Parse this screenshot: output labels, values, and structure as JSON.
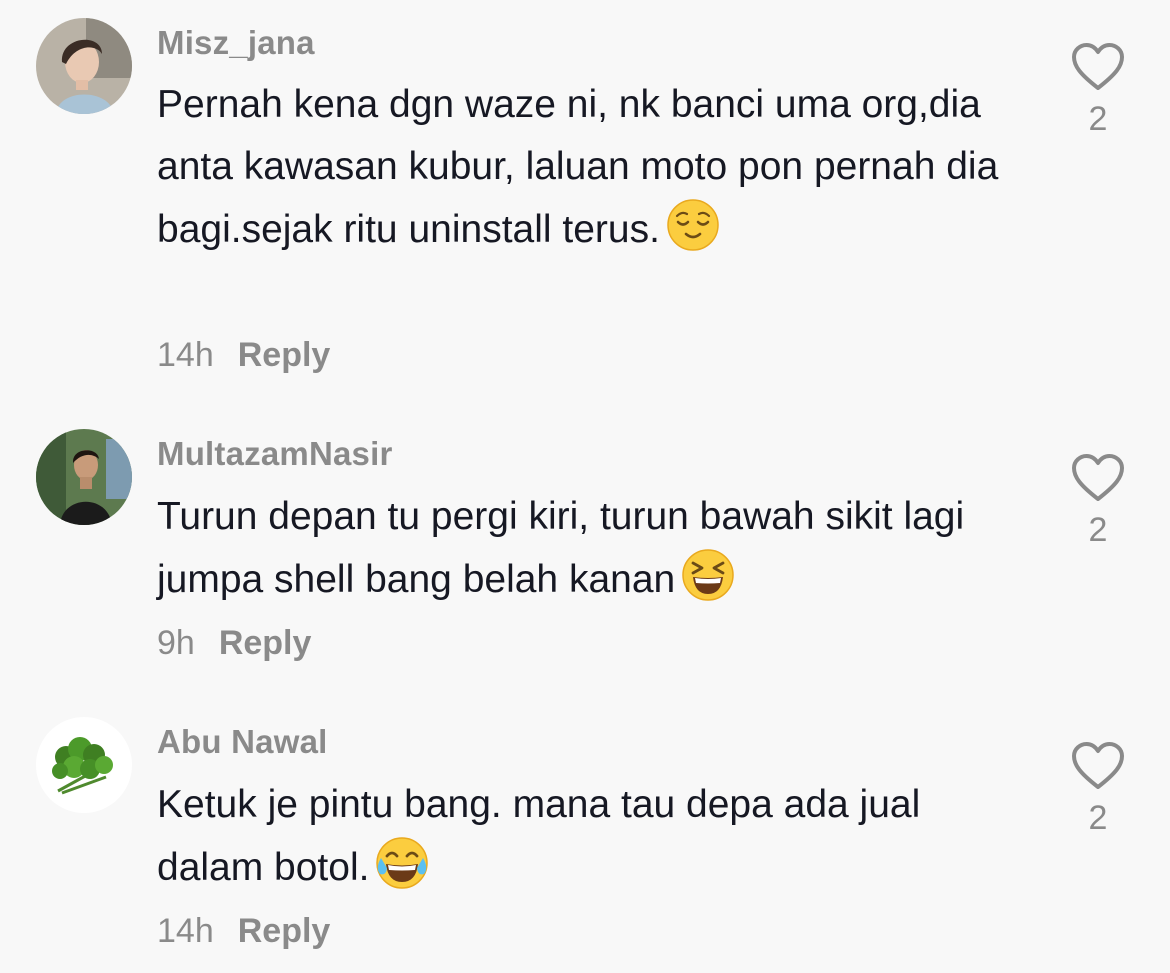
{
  "comments": [
    {
      "username": "Misz_jana",
      "text": "Pernah kena dgn waze ni, nk banci uma org,dia anta kawasan kubur, laluan moto pon pernah dia bagi.sejak ritu uninstall terus.",
      "emoji": "relieved-face",
      "time": "14h",
      "reply": "Reply",
      "likes": "2"
    },
    {
      "username": "MultazamNasir",
      "text": "Turun depan tu pergi kiri, turun bawah sikit lagi jumpa shell bang belah kanan",
      "emoji": "grinning-squinting-face",
      "time": "9h",
      "reply": "Reply",
      "likes": "2"
    },
    {
      "username": "Abu Nawal",
      "text": "Ketuk je pintu bang. mana tau depa ada jual dalam botol.",
      "emoji": "face-with-tears-of-joy",
      "time": "14h",
      "reply": "Reply",
      "likes": "2"
    }
  ],
  "colors": {
    "background": "#f8f8f8",
    "text": "#161823",
    "secondary": "#8a8a8a"
  }
}
